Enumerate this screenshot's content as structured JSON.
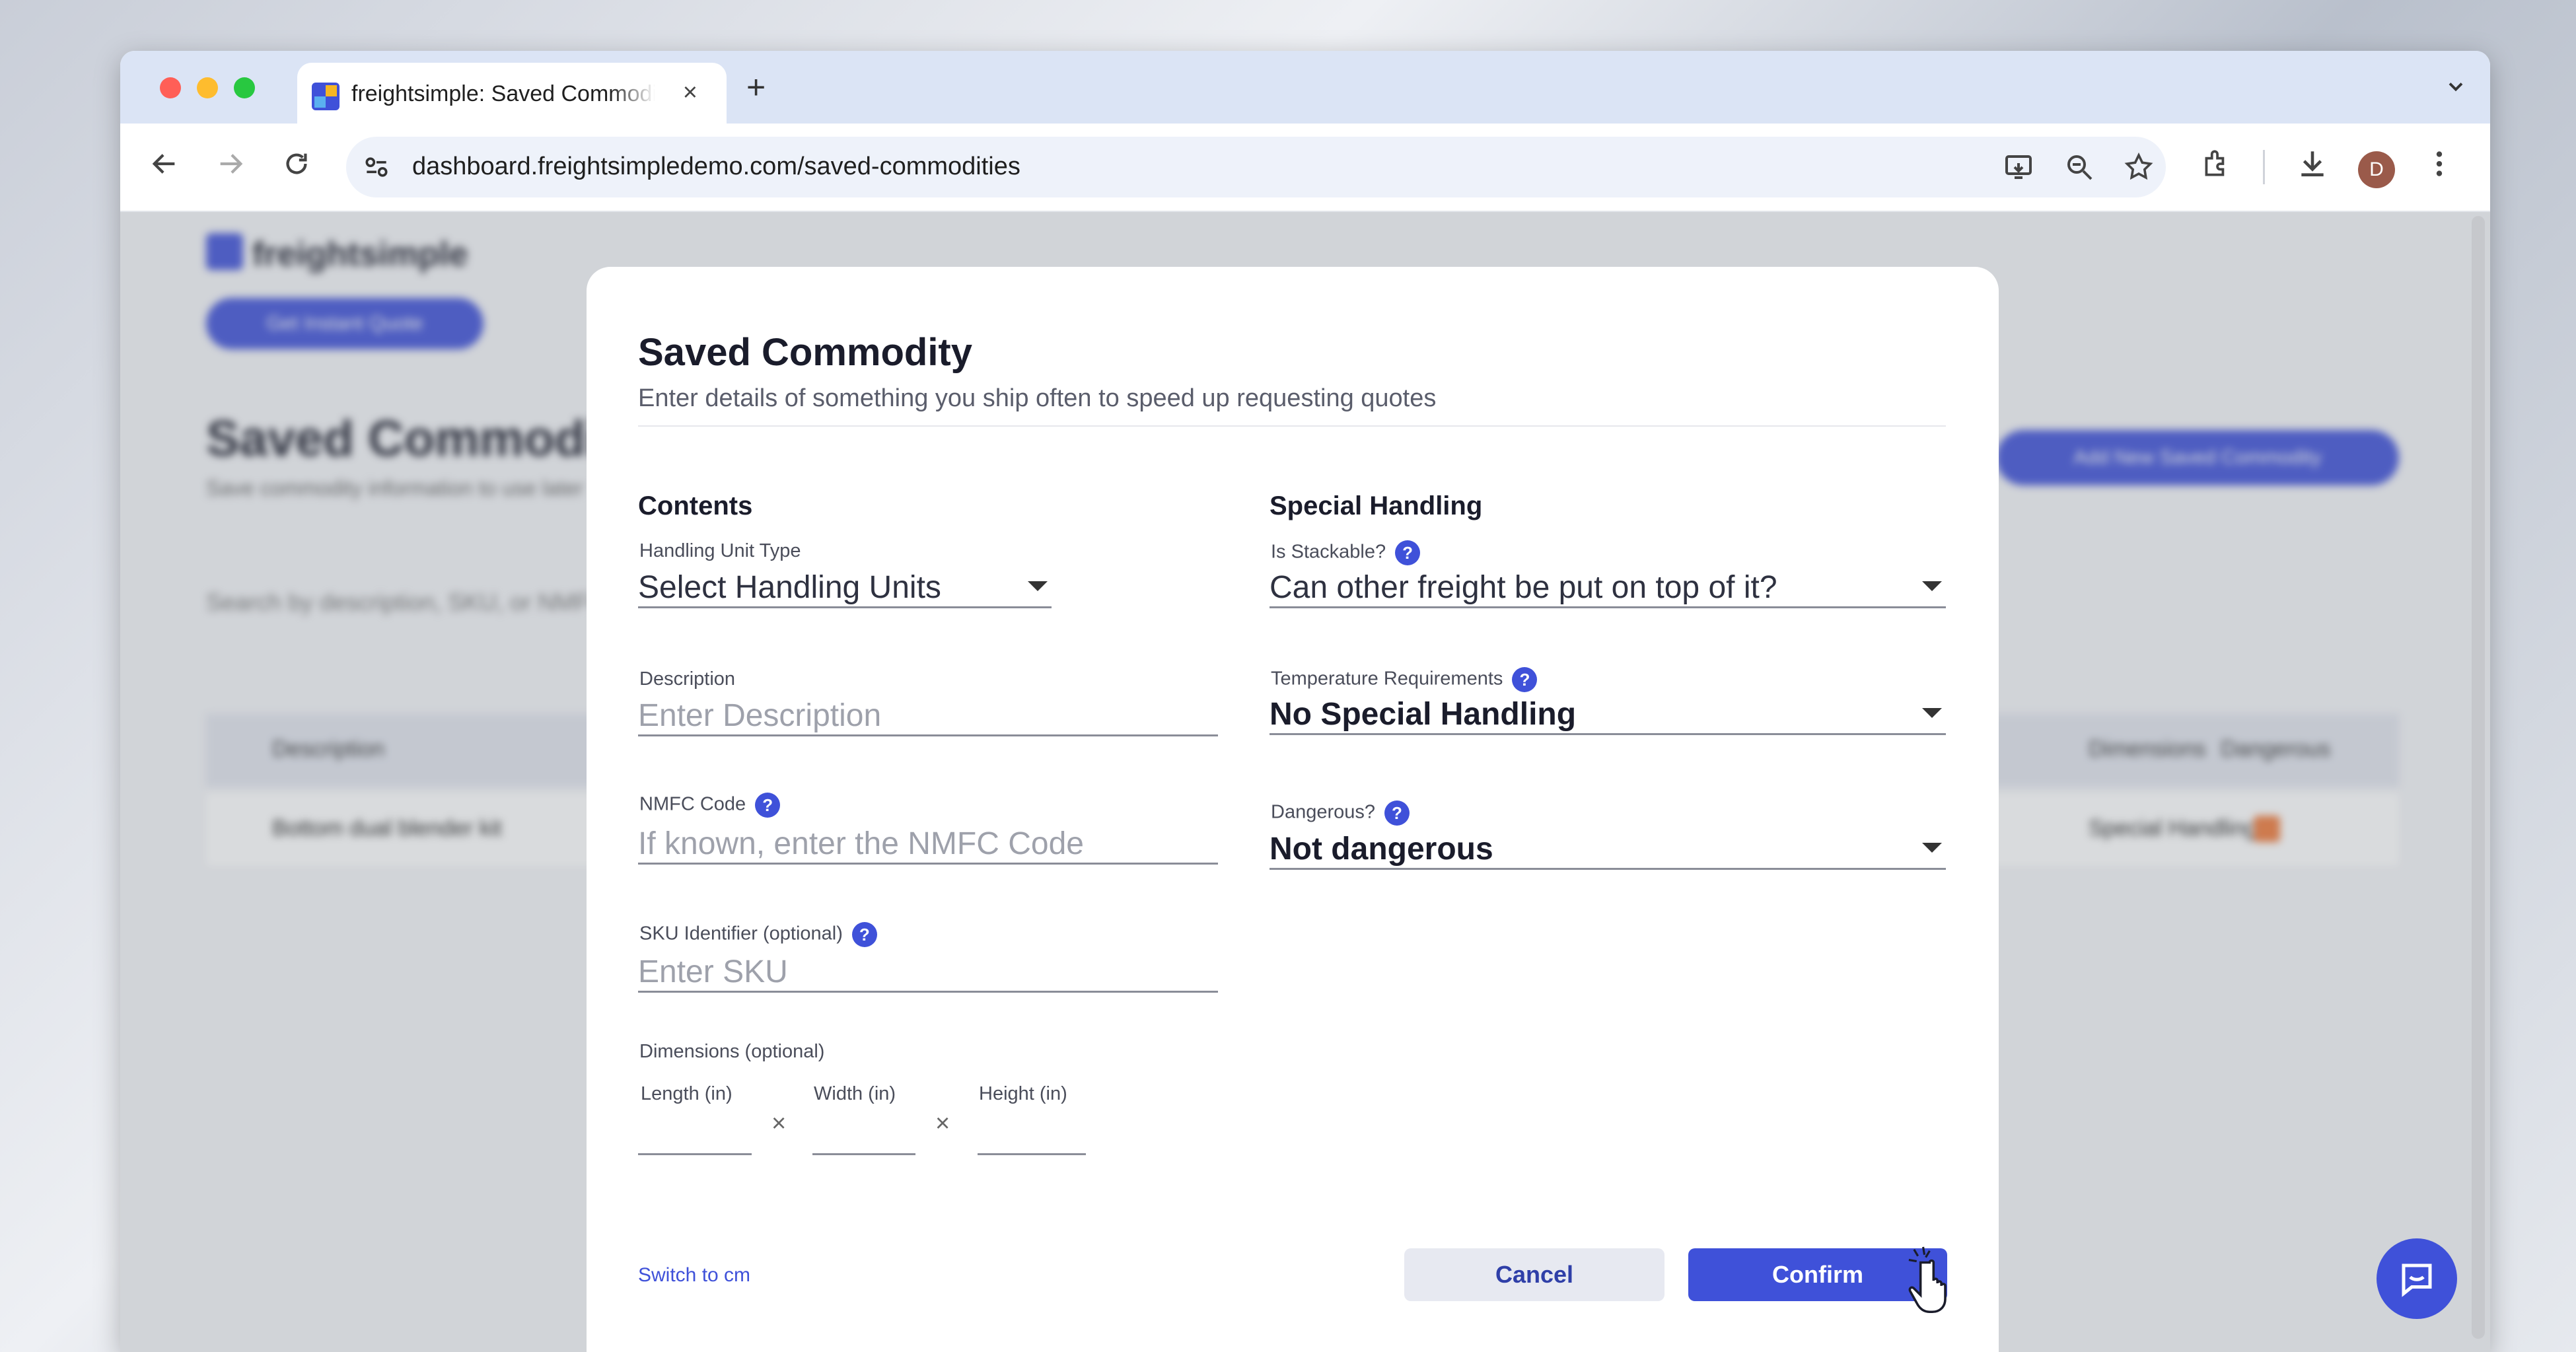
{
  "browser": {
    "tab_title": "freightsimple: Saved Commodities",
    "tab_close": "×",
    "new_tab": "+",
    "url": "dashboard.freightsimpledemo.com/saved-commodities",
    "profile_initial": "D"
  },
  "background_page": {
    "logo_text": "freightsimple",
    "nav_button": "Get Instant Quote",
    "page_title": "Saved Commodities",
    "page_subtitle": "Save commodity information to use later",
    "add_button": "Add New Saved Commodity",
    "search_placeholder": "Search by description, SKU, or NMFC",
    "columns": [
      "Description",
      "Dimensions",
      "Dangerous"
    ],
    "rows": [
      [
        "Bottom dual blender kit",
        "Special Handling"
      ]
    ]
  },
  "modal": {
    "title": "Saved Commodity",
    "subtitle": "Enter details of something you ship often to speed up requesting quotes",
    "contents_heading": "Contents",
    "special_heading": "Special Handling",
    "handling_unit_label": "Handling Unit Type",
    "handling_unit_value": "Select Handling Units",
    "description_label": "Description",
    "description_placeholder": "Enter Description",
    "nmfc_label": "NMFC Code",
    "nmfc_placeholder": "If known, enter the NMFC Code",
    "sku_label": "SKU Identifier (optional)",
    "sku_placeholder": "Enter SKU",
    "dimensions_label": "Dimensions (optional)",
    "length_label": "Length (in)",
    "width_label": "Width (in)",
    "height_label": "Height (in)",
    "times_symbol": "×",
    "stackable_label": "Is Stackable?",
    "stackable_value": "Can other freight be put on top of it?",
    "temperature_label": "Temperature Requirements",
    "temperature_value": "No Special Handling",
    "dangerous_label": "Dangerous?",
    "dangerous_value": "Not dangerous",
    "help_glyph": "?",
    "switch_units_link": "Switch to cm",
    "cancel_label": "Cancel",
    "confirm_label": "Confirm"
  },
  "colors": {
    "accent": "#3f51d9",
    "title_text": "#1a1c2b",
    "tabstrip": "#dbe4f5"
  },
  "icons": [
    "back-arrow-icon",
    "forward-arrow-icon",
    "reload-icon",
    "site-settings-icon",
    "cast-icon",
    "zoom-icon",
    "star-icon",
    "extensions-icon",
    "download-icon",
    "more-vert-icon",
    "chat-icon",
    "pointer-cursor-icon"
  ]
}
